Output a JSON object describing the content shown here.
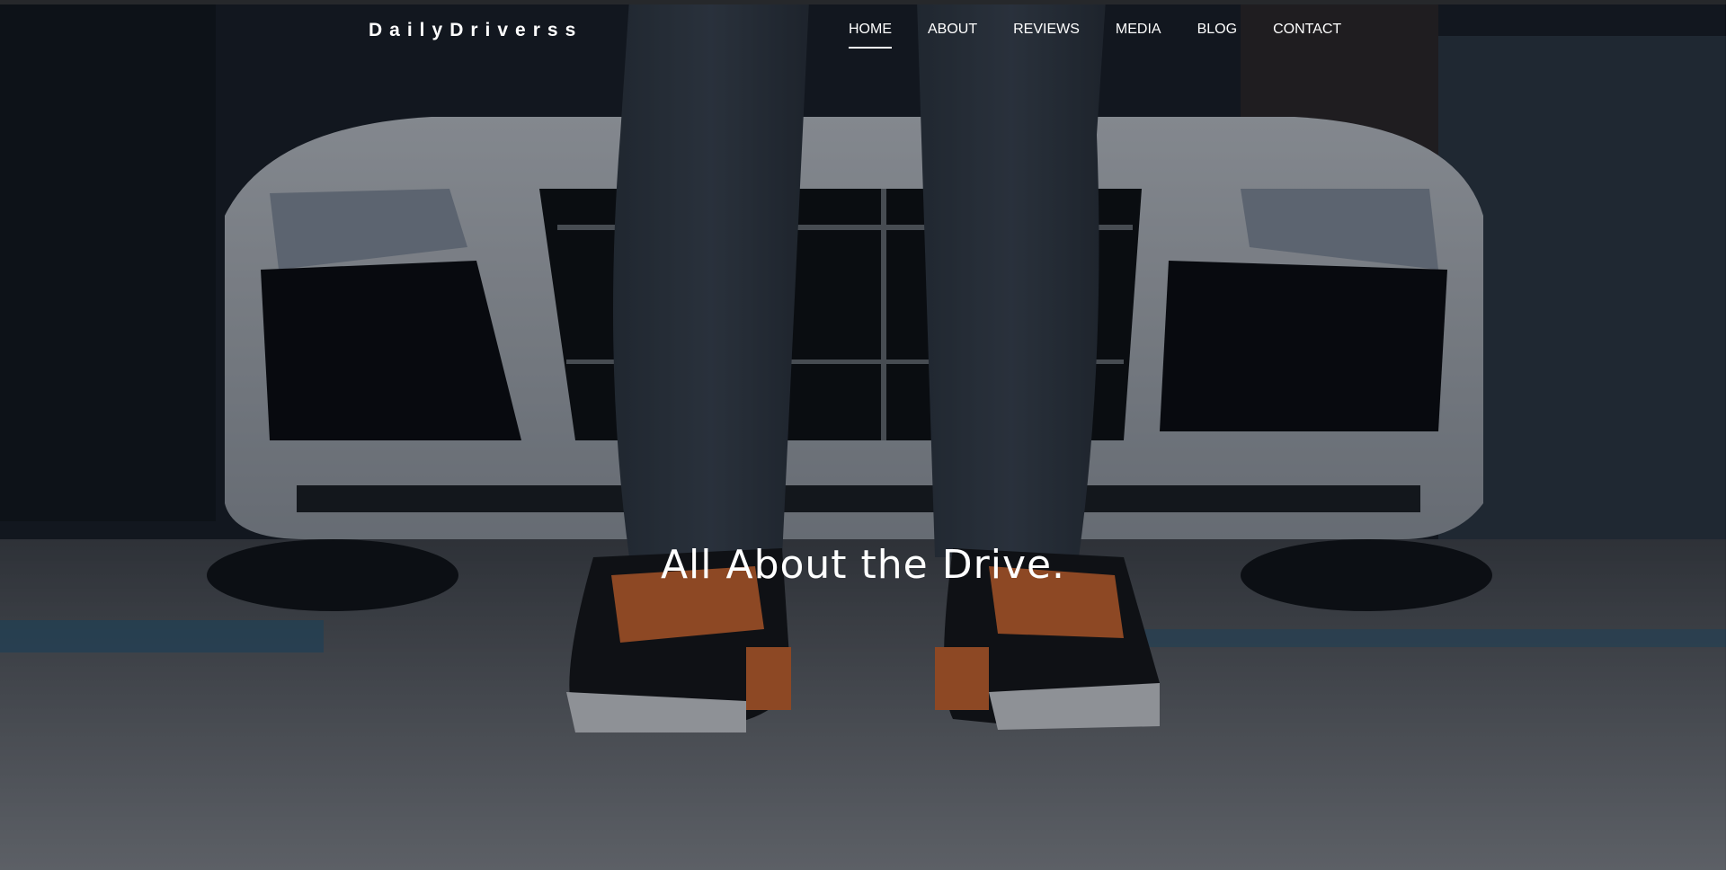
{
  "brand": {
    "name": "DailyDriverss"
  },
  "nav": {
    "items": [
      {
        "label": "HOME",
        "active": true
      },
      {
        "label": "ABOUT"
      },
      {
        "label": "REVIEWS"
      },
      {
        "label": "MEDIA"
      },
      {
        "label": "BLOG"
      },
      {
        "label": "CONTACT"
      }
    ]
  },
  "hero": {
    "headline": "All About the Drive."
  }
}
